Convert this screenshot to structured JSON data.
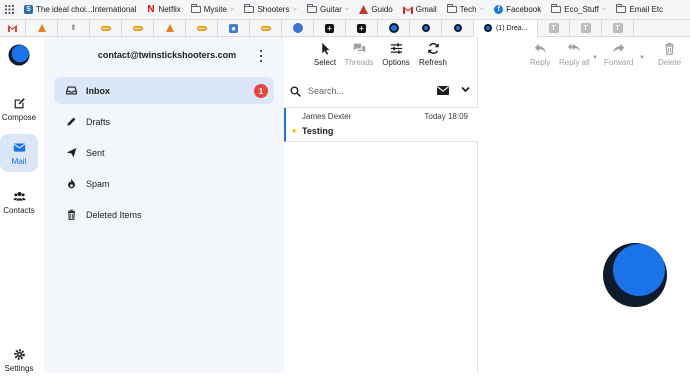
{
  "bookmarks": [
    {
      "label": "",
      "icon": "apps-grid-icon"
    },
    {
      "label": "The ideal choi...International",
      "icon": "site-favicon-icon"
    },
    {
      "label": "Netflix",
      "icon": "netflix-icon"
    },
    {
      "label": "Mysite",
      "icon": "folder-icon"
    },
    {
      "label": "Shooters",
      "icon": "folder-icon"
    },
    {
      "label": "Guitar",
      "icon": "folder-icon"
    },
    {
      "label": "Guido",
      "icon": "guido-icon"
    },
    {
      "label": "Gmail",
      "icon": "gmail-icon"
    },
    {
      "label": "Tech",
      "icon": "folder-icon"
    },
    {
      "label": "Facebook",
      "icon": "facebook-icon"
    },
    {
      "label": "Eco_Stuff",
      "icon": "folder-icon"
    },
    {
      "label": "Email Etc",
      "icon": "folder-icon"
    }
  ],
  "active_tab": {
    "label": "(1) Drea..."
  },
  "colors": {
    "accent": "#1a73e8",
    "badge": "#e8453c",
    "sidebar_bg": "#f3f6fb",
    "selected_bg": "#dbe7f8"
  },
  "rail": {
    "compose": "Compose",
    "mail": "Mail",
    "contacts": "Contacts",
    "settings": "Settings"
  },
  "account": "contact@twinstickshooters.com",
  "folders": [
    {
      "label": "Inbox",
      "icon": "inbox-icon",
      "badge": "1"
    },
    {
      "label": "Drafts",
      "icon": "pencil-icon"
    },
    {
      "label": "Sent",
      "icon": "send-icon"
    },
    {
      "label": "Spam",
      "icon": "fire-icon"
    },
    {
      "label": "Deleted Items",
      "icon": "trash-icon"
    }
  ],
  "list_toolbar": {
    "select": "Select",
    "threads": "Threads",
    "options": "Options",
    "refresh": "Refresh"
  },
  "search": {
    "placeholder": "Search..."
  },
  "messages": [
    {
      "from": "James Dexter",
      "time": "Today 18:09",
      "subject": "Testing",
      "starred": true
    }
  ],
  "reading_toolbar": {
    "reply": "Reply",
    "reply_all": "Reply all",
    "forward": "Forward",
    "delete": "Delete"
  }
}
